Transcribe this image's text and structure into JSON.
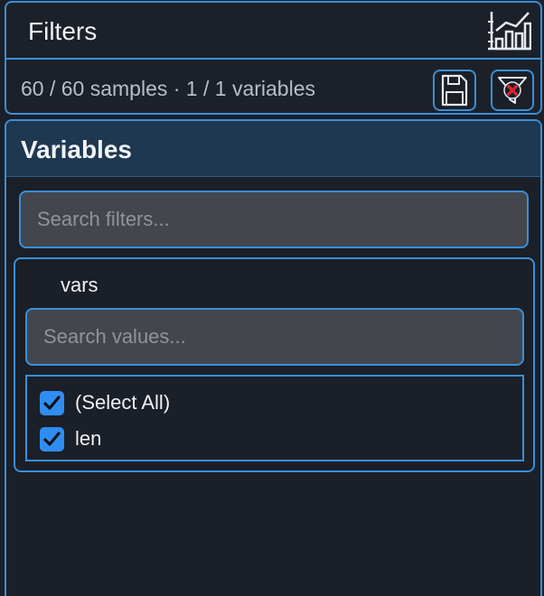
{
  "header": {
    "title": "Filters",
    "chart_icon": "bar-chart-icon",
    "status": "60 / 60 samples · 1 / 1 variables",
    "buttons": [
      {
        "name": "save-filters",
        "icon": "floppy-disk-icon"
      },
      {
        "name": "clear-filters",
        "icon": "filter-clear-icon"
      }
    ]
  },
  "panel": {
    "title": "Variables",
    "search_placeholder": "Search filters...",
    "variable": {
      "name": "vars",
      "search_placeholder": "Search values...",
      "values": [
        {
          "label": "(Select All)",
          "checked": true
        },
        {
          "label": "len",
          "checked": true
        }
      ]
    }
  },
  "colors": {
    "accent": "#3a8fd8",
    "checkbox": "#2f8df2",
    "panel_header_bg": "#1f3851",
    "background": "#1b1f27",
    "input_bg": "#43464c",
    "clear_icon_red": "#e0222b"
  }
}
